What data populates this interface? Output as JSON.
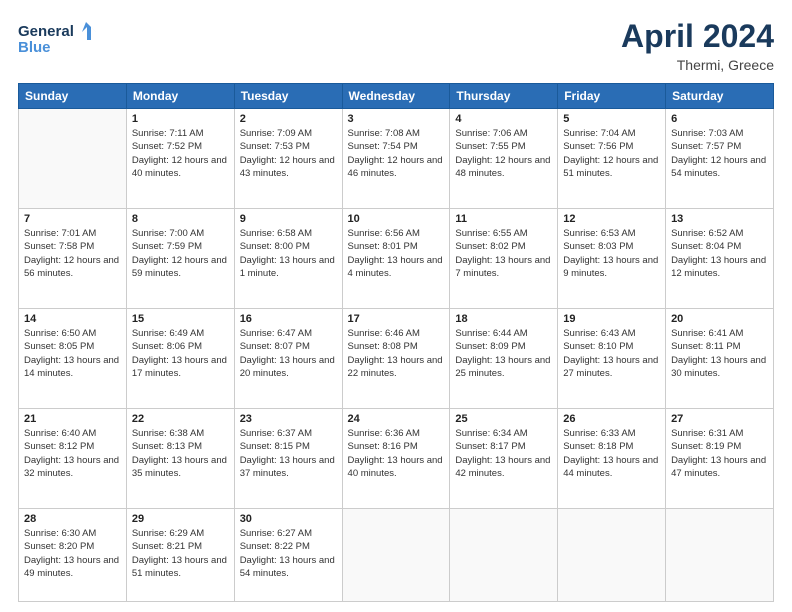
{
  "header": {
    "logo_line1": "General",
    "logo_line2": "Blue",
    "month": "April 2024",
    "location": "Thermi, Greece"
  },
  "weekdays": [
    "Sunday",
    "Monday",
    "Tuesday",
    "Wednesday",
    "Thursday",
    "Friday",
    "Saturday"
  ],
  "weeks": [
    [
      {
        "day": "",
        "empty": true
      },
      {
        "day": "1",
        "sunrise": "7:11 AM",
        "sunset": "7:52 PM",
        "daylight": "12 hours and 40 minutes."
      },
      {
        "day": "2",
        "sunrise": "7:09 AM",
        "sunset": "7:53 PM",
        "daylight": "12 hours and 43 minutes."
      },
      {
        "day": "3",
        "sunrise": "7:08 AM",
        "sunset": "7:54 PM",
        "daylight": "12 hours and 46 minutes."
      },
      {
        "day": "4",
        "sunrise": "7:06 AM",
        "sunset": "7:55 PM",
        "daylight": "12 hours and 48 minutes."
      },
      {
        "day": "5",
        "sunrise": "7:04 AM",
        "sunset": "7:56 PM",
        "daylight": "12 hours and 51 minutes."
      },
      {
        "day": "6",
        "sunrise": "7:03 AM",
        "sunset": "7:57 PM",
        "daylight": "12 hours and 54 minutes."
      }
    ],
    [
      {
        "day": "7",
        "sunrise": "7:01 AM",
        "sunset": "7:58 PM",
        "daylight": "12 hours and 56 minutes."
      },
      {
        "day": "8",
        "sunrise": "7:00 AM",
        "sunset": "7:59 PM",
        "daylight": "12 hours and 59 minutes."
      },
      {
        "day": "9",
        "sunrise": "6:58 AM",
        "sunset": "8:00 PM",
        "daylight": "13 hours and 1 minute."
      },
      {
        "day": "10",
        "sunrise": "6:56 AM",
        "sunset": "8:01 PM",
        "daylight": "13 hours and 4 minutes."
      },
      {
        "day": "11",
        "sunrise": "6:55 AM",
        "sunset": "8:02 PM",
        "daylight": "13 hours and 7 minutes."
      },
      {
        "day": "12",
        "sunrise": "6:53 AM",
        "sunset": "8:03 PM",
        "daylight": "13 hours and 9 minutes."
      },
      {
        "day": "13",
        "sunrise": "6:52 AM",
        "sunset": "8:04 PM",
        "daylight": "13 hours and 12 minutes."
      }
    ],
    [
      {
        "day": "14",
        "sunrise": "6:50 AM",
        "sunset": "8:05 PM",
        "daylight": "13 hours and 14 minutes."
      },
      {
        "day": "15",
        "sunrise": "6:49 AM",
        "sunset": "8:06 PM",
        "daylight": "13 hours and 17 minutes."
      },
      {
        "day": "16",
        "sunrise": "6:47 AM",
        "sunset": "8:07 PM",
        "daylight": "13 hours and 20 minutes."
      },
      {
        "day": "17",
        "sunrise": "6:46 AM",
        "sunset": "8:08 PM",
        "daylight": "13 hours and 22 minutes."
      },
      {
        "day": "18",
        "sunrise": "6:44 AM",
        "sunset": "8:09 PM",
        "daylight": "13 hours and 25 minutes."
      },
      {
        "day": "19",
        "sunrise": "6:43 AM",
        "sunset": "8:10 PM",
        "daylight": "13 hours and 27 minutes."
      },
      {
        "day": "20",
        "sunrise": "6:41 AM",
        "sunset": "8:11 PM",
        "daylight": "13 hours and 30 minutes."
      }
    ],
    [
      {
        "day": "21",
        "sunrise": "6:40 AM",
        "sunset": "8:12 PM",
        "daylight": "13 hours and 32 minutes."
      },
      {
        "day": "22",
        "sunrise": "6:38 AM",
        "sunset": "8:13 PM",
        "daylight": "13 hours and 35 minutes."
      },
      {
        "day": "23",
        "sunrise": "6:37 AM",
        "sunset": "8:15 PM",
        "daylight": "13 hours and 37 minutes."
      },
      {
        "day": "24",
        "sunrise": "6:36 AM",
        "sunset": "8:16 PM",
        "daylight": "13 hours and 40 minutes."
      },
      {
        "day": "25",
        "sunrise": "6:34 AM",
        "sunset": "8:17 PM",
        "daylight": "13 hours and 42 minutes."
      },
      {
        "day": "26",
        "sunrise": "6:33 AM",
        "sunset": "8:18 PM",
        "daylight": "13 hours and 44 minutes."
      },
      {
        "day": "27",
        "sunrise": "6:31 AM",
        "sunset": "8:19 PM",
        "daylight": "13 hours and 47 minutes."
      }
    ],
    [
      {
        "day": "28",
        "sunrise": "6:30 AM",
        "sunset": "8:20 PM",
        "daylight": "13 hours and 49 minutes."
      },
      {
        "day": "29",
        "sunrise": "6:29 AM",
        "sunset": "8:21 PM",
        "daylight": "13 hours and 51 minutes."
      },
      {
        "day": "30",
        "sunrise": "6:27 AM",
        "sunset": "8:22 PM",
        "daylight": "13 hours and 54 minutes."
      },
      {
        "day": "",
        "empty": true
      },
      {
        "day": "",
        "empty": true
      },
      {
        "day": "",
        "empty": true
      },
      {
        "day": "",
        "empty": true
      }
    ]
  ]
}
